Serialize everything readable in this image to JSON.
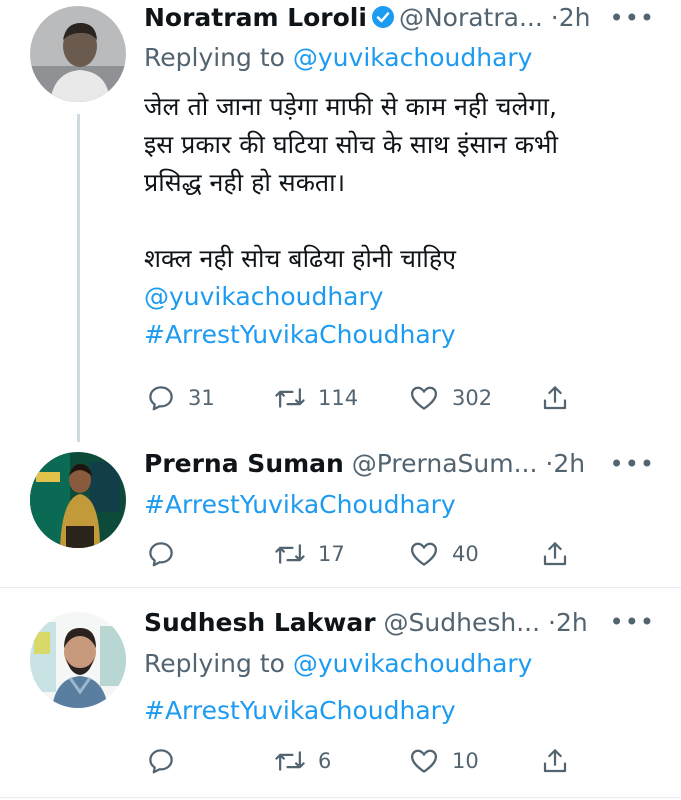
{
  "tweets": [
    {
      "author": "Noratram Loroli",
      "handle": "@Noratra...",
      "dot": "·",
      "time": "2h",
      "more": "•••",
      "replying_prefix": "Replying to ",
      "replying_handle": "@yuvikachoudhary",
      "lines": [
        "जेल तो जाना पड़ेगा माफी से काम नही चलेगा,",
        "इस प्रकार की घटिया सोच के साथ इंसान कभी",
        "प्रसिद्ध नही हो सकता।",
        "शक्ल नही सोच बढिया होनी चाहिए"
      ],
      "mention": "@yuvikachoudhary",
      "hashtag": "#ArrestYuvikaChoudhary",
      "replies": "31",
      "retweets": "114",
      "likes": "302"
    },
    {
      "author": "Prerna Suman",
      "handle": "@PrernaSum...",
      "dot": "·",
      "time": "2h",
      "more": "•••",
      "hashtag": "#ArrestYuvikaChoudhary",
      "retweets": "17",
      "likes": "40"
    },
    {
      "author": "Sudhesh Lakwar",
      "handle": "@Sudhesh...",
      "dot": "·",
      "time": "2h",
      "more": "•••",
      "replying_prefix": "Replying to ",
      "replying_handle": "@yuvikachoudhary",
      "hashtag": "#ArrestYuvikaChoudhary",
      "retweets": "6",
      "likes": "10"
    }
  ],
  "icons": {
    "reply": "reply-icon",
    "retweet": "retweet-icon",
    "like": "heart-icon",
    "share": "share-icon",
    "verified": "verified-badge-icon"
  },
  "colors": {
    "link": "#1d9bf0",
    "muted": "#536471",
    "text": "#0f1419",
    "verified": "#1d9bf0"
  }
}
